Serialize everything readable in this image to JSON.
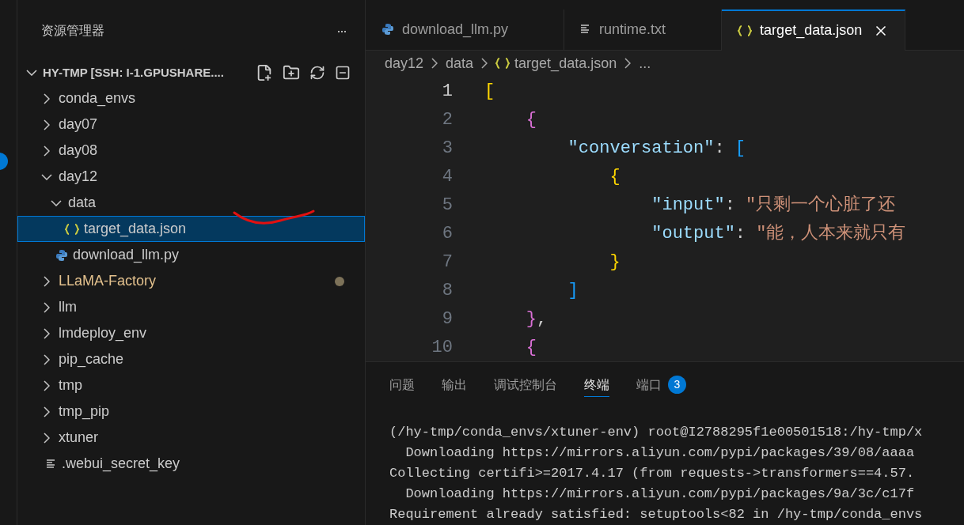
{
  "explorer": {
    "title": "资源管理器",
    "more": "···",
    "root": {
      "label": "HY-TMP [SSH: I-1.GPUSHARE....",
      "expanded": true
    },
    "items": [
      {
        "label": "conda_envs",
        "kind": "folder",
        "expanded": false,
        "selected": false,
        "modified": false
      },
      {
        "label": "day07",
        "kind": "folder",
        "expanded": false,
        "selected": false,
        "modified": false
      },
      {
        "label": "day08",
        "kind": "folder",
        "expanded": false,
        "selected": false,
        "modified": false
      },
      {
        "label": "day12",
        "kind": "folder",
        "expanded": true,
        "selected": false,
        "modified": false,
        "children": [
          {
            "label": "data",
            "kind": "folder",
            "expanded": true,
            "selected": false,
            "modified": false,
            "children": [
              {
                "label": "target_data.json",
                "kind": "json",
                "selected": true,
                "modified": false
              }
            ]
          },
          {
            "label": "download_llm.py",
            "kind": "python",
            "selected": false,
            "modified": false
          }
        ]
      },
      {
        "label": "LLaMA-Factory",
        "kind": "folder",
        "expanded": false,
        "selected": false,
        "modified": true
      },
      {
        "label": "llm",
        "kind": "folder",
        "expanded": false,
        "selected": false,
        "modified": false
      },
      {
        "label": "lmdeploy_env",
        "kind": "folder",
        "expanded": false,
        "selected": false,
        "modified": false
      },
      {
        "label": "pip_cache",
        "kind": "folder",
        "expanded": false,
        "selected": false,
        "modified": false
      },
      {
        "label": "tmp",
        "kind": "folder",
        "expanded": false,
        "selected": false,
        "modified": false
      },
      {
        "label": "tmp_pip",
        "kind": "folder",
        "expanded": false,
        "selected": false,
        "modified": false
      },
      {
        "label": "xtuner",
        "kind": "folder",
        "expanded": false,
        "selected": false,
        "modified": false
      },
      {
        "label": ".webui_secret_key",
        "kind": "text",
        "selected": false,
        "modified": false
      }
    ]
  },
  "tabs": [
    {
      "label": "download_llm.py",
      "kind": "python",
      "selected": false
    },
    {
      "label": "runtime.txt",
      "kind": "text",
      "selected": false
    },
    {
      "label": "target_data.json",
      "kind": "json",
      "selected": true
    }
  ],
  "breadcrumb": [
    {
      "label": "day12",
      "kind": "folder"
    },
    {
      "label": "data",
      "kind": "folder"
    },
    {
      "label": "target_data.json",
      "kind": "json"
    },
    {
      "label": "...",
      "kind": "symbol"
    }
  ],
  "code_lines": [
    {
      "number": "1",
      "active": true,
      "tokens": [
        {
          "kind": "bracket1",
          "text": "["
        }
      ]
    },
    {
      "number": "2",
      "active": false,
      "tokens": [
        {
          "kind": "bracket2",
          "text": "    {"
        }
      ]
    },
    {
      "number": "3",
      "active": false,
      "tokens": [
        {
          "kind": "key",
          "text": "        \"conversation\""
        },
        {
          "kind": "punct",
          "text": ": "
        },
        {
          "kind": "bracket3",
          "text": "["
        }
      ]
    },
    {
      "number": "4",
      "active": false,
      "tokens": [
        {
          "kind": "bracket1",
          "text": "            {"
        }
      ]
    },
    {
      "number": "5",
      "active": false,
      "tokens": [
        {
          "kind": "key",
          "text": "                \"input\""
        },
        {
          "kind": "punct",
          "text": ": "
        },
        {
          "kind": "string",
          "text": "\"只剩一个心脏了还"
        }
      ]
    },
    {
      "number": "6",
      "active": false,
      "tokens": [
        {
          "kind": "key",
          "text": "                \"output\""
        },
        {
          "kind": "punct",
          "text": ": "
        },
        {
          "kind": "string",
          "text": "\"能，人本来就只有"
        }
      ]
    },
    {
      "number": "7",
      "active": false,
      "tokens": [
        {
          "kind": "bracket1",
          "text": "            }"
        }
      ]
    },
    {
      "number": "8",
      "active": false,
      "tokens": [
        {
          "kind": "bracket3",
          "text": "        ]"
        }
      ]
    },
    {
      "number": "9",
      "active": false,
      "tokens": [
        {
          "kind": "bracket2",
          "text": "    }"
        },
        {
          "kind": "punct",
          "text": ","
        }
      ]
    },
    {
      "number": "10",
      "active": false,
      "tokens": [
        {
          "kind": "bracket2",
          "text": "    {"
        }
      ]
    }
  ],
  "panel_tabs": [
    {
      "label": "问题",
      "selected": false
    },
    {
      "label": "输出",
      "selected": false
    },
    {
      "label": "调试控制台",
      "selected": false
    },
    {
      "label": "终端",
      "selected": true
    },
    {
      "label": "端口",
      "selected": false,
      "badge": "3"
    }
  ],
  "terminal_lines": [
    "(/hy-tmp/conda_envs/xtuner-env) root@I2788295f1e00501518:/hy-tmp/x",
    "  Downloading https://mirrors.aliyun.com/pypi/packages/39/08/aaaa",
    "Collecting certifi>=2017.4.17 (from requests->transformers==4.57.",
    "  Downloading https://mirrors.aliyun.com/pypi/packages/9a/3c/c17f",
    "Requirement already satisfied: setuptools<82 in /hy-tmp/conda_envs"
  ]
}
